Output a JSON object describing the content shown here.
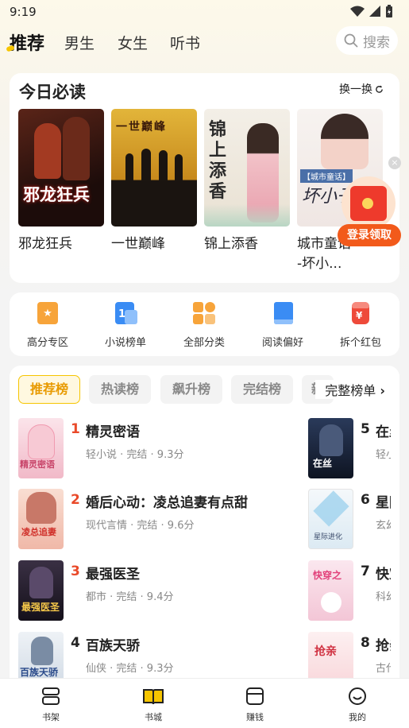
{
  "status": {
    "time": "9:19"
  },
  "topnav": {
    "tabs": [
      {
        "label": "推荐",
        "active": true
      },
      {
        "label": "男生",
        "active": false
      },
      {
        "label": "女生",
        "active": false
      },
      {
        "label": "听书",
        "active": false
      }
    ],
    "search_label": "搜索"
  },
  "must_read": {
    "title": "今日必读",
    "refresh_label": "换一换",
    "books": [
      {
        "name": "邪龙狂兵",
        "cover_text": "邪龙狂兵",
        "cover_color": "#3a1a14"
      },
      {
        "name": "一世巅峰",
        "cover_text": "一世巅峰",
        "cover_color": "#d9a21c"
      },
      {
        "name": "锦上添香",
        "cover_text": "锦上添香",
        "cover_color": "#f2ede6"
      },
      {
        "name": "城市童话--坏小...",
        "cover_text": "坏小子",
        "cover_color": "#f4efec"
      }
    ]
  },
  "promo": {
    "label": "登录领取",
    "close": "×"
  },
  "quick_links": [
    {
      "label": "高分专区",
      "icon": "star-badge-icon",
      "color": "#f7a43a"
    },
    {
      "label": "小说榜单",
      "icon": "ranking-list-icon",
      "color": "#3a8cf4"
    },
    {
      "label": "全部分类",
      "icon": "category-grid-icon",
      "color": "#f7a43a"
    },
    {
      "label": "阅读偏好",
      "icon": "bookmark-book-icon",
      "color": "#3a8cf4"
    },
    {
      "label": "拆个红包",
      "icon": "red-packet-icon",
      "color": "#ee4a3a"
    }
  ],
  "ranking": {
    "tabs": [
      {
        "label": "推荐榜",
        "active": true
      },
      {
        "label": "热读榜",
        "active": false
      },
      {
        "label": "飙升榜",
        "active": false
      },
      {
        "label": "完结榜",
        "active": false
      },
      {
        "label": "新",
        "active": false
      }
    ],
    "more_label": "完整榜单",
    "entries_left": [
      {
        "rank": "1",
        "name": "精灵密语",
        "meta": "轻小说 · 完结 · 9.3分",
        "cover_text": "精灵密语",
        "cover_color": "#f6d3dc"
      },
      {
        "rank": "2",
        "name": "婚后心动：凌总追妻有点甜",
        "meta": "现代言情 · 完结 · 9.6分",
        "cover_text": "凌总追妻",
        "cover_color": "#f7d5c8"
      },
      {
        "rank": "3",
        "name": "最强医圣",
        "meta": "都市 · 完结 · 9.4分",
        "cover_text": "最强医圣",
        "cover_color": "#2a2030"
      },
      {
        "rank": "4",
        "name": "百族天骄",
        "meta": "仙侠 · 完结 · 9.3分",
        "cover_text": "百族天骄",
        "cover_color": "#dfe6ee"
      }
    ],
    "entries_right": [
      {
        "rank": "5",
        "name": "在丝",
        "meta": "轻小",
        "cover_text": "在丝",
        "cover_color": "#1e2a44"
      },
      {
        "rank": "6",
        "name": "星际",
        "meta": "玄幻",
        "cover_text": "星际进化",
        "cover_color": "#e8f2f8"
      },
      {
        "rank": "7",
        "name": "快穿",
        "meta": "科幻",
        "cover_text": "快穿之",
        "cover_color": "#f7dbe6"
      },
      {
        "rank": "8",
        "name": "抢亲",
        "meta": "古代",
        "cover_text": "抢亲",
        "cover_color": "#fbe8ea"
      }
    ]
  },
  "bottom_nav": [
    {
      "label": "书架",
      "icon": "bookshelf-icon"
    },
    {
      "label": "书城",
      "icon": "open-book-icon"
    },
    {
      "label": "赚钱",
      "icon": "wallet-icon"
    },
    {
      "label": "我的",
      "icon": "profile-smile-icon"
    }
  ]
}
